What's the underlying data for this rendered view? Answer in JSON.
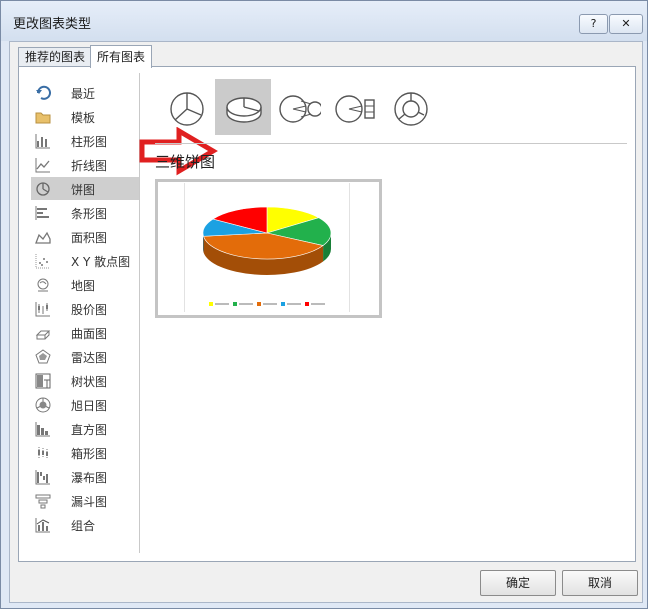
{
  "window": {
    "title": "更改图表类型",
    "help_label": "?",
    "close_label": "✕"
  },
  "tabs": [
    {
      "label": "推荐的图表",
      "active": false
    },
    {
      "label": "所有图表",
      "active": true
    }
  ],
  "categories": [
    {
      "label": "最近",
      "icon": "recent-icon"
    },
    {
      "label": "模板",
      "icon": "folder-icon"
    },
    {
      "label": "柱形图",
      "icon": "column-chart-icon"
    },
    {
      "label": "折线图",
      "icon": "line-chart-icon"
    },
    {
      "label": "饼图",
      "icon": "pie-chart-icon",
      "selected": true
    },
    {
      "label": "条形图",
      "icon": "bar-chart-icon"
    },
    {
      "label": "面积图",
      "icon": "area-chart-icon"
    },
    {
      "label": "X Y 散点图",
      "icon": "scatter-chart-icon"
    },
    {
      "label": "地图",
      "icon": "map-chart-icon"
    },
    {
      "label": "股价图",
      "icon": "stock-chart-icon"
    },
    {
      "label": "曲面图",
      "icon": "surface-chart-icon"
    },
    {
      "label": "雷达图",
      "icon": "radar-chart-icon"
    },
    {
      "label": "树状图",
      "icon": "treemap-chart-icon"
    },
    {
      "label": "旭日图",
      "icon": "sunburst-chart-icon"
    },
    {
      "label": "直方图",
      "icon": "histogram-chart-icon"
    },
    {
      "label": "箱形图",
      "icon": "box-chart-icon"
    },
    {
      "label": "瀑布图",
      "icon": "waterfall-chart-icon"
    },
    {
      "label": "漏斗图",
      "icon": "funnel-chart-icon"
    },
    {
      "label": "组合",
      "icon": "combo-chart-icon"
    }
  ],
  "subtypes": [
    {
      "icon": "pie-subtype-icon"
    },
    {
      "icon": "3d-pie-subtype-icon",
      "selected": true
    },
    {
      "icon": "pie-of-pie-subtype-icon"
    },
    {
      "icon": "bar-of-pie-subtype-icon"
    },
    {
      "icon": "doughnut-subtype-icon"
    }
  ],
  "selected_chart": {
    "title": "三维饼图"
  },
  "preview": {
    "slice_colors": [
      "#ffff00",
      "#22b14c",
      "#e36c0a",
      "#1ba1e2",
      "#ff0000"
    ],
    "slice_fractions": [
      0.15,
      0.18,
      0.4,
      0.11,
      0.16
    ]
  },
  "buttons": {
    "ok": "确定",
    "cancel": "取消"
  },
  "colors": {
    "arrow": "#e02020",
    "selection": "#cbcbcb"
  }
}
